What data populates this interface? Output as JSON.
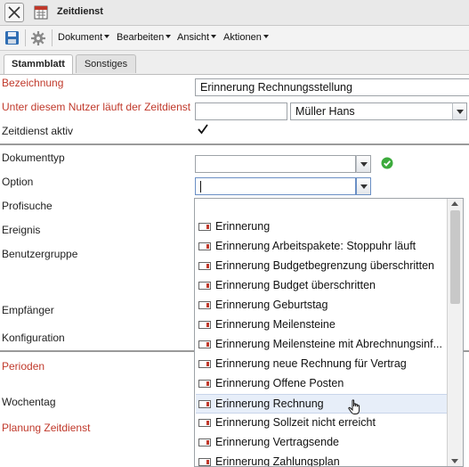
{
  "window": {
    "title": "Zeitdienst"
  },
  "toolbar": {
    "menus": [
      "Dokument",
      "Bearbeiten",
      "Ansicht",
      "Aktionen"
    ]
  },
  "tabs": [
    {
      "label": "Stammblatt",
      "active": true
    },
    {
      "label": "Sonstiges",
      "active": false
    }
  ],
  "form": {
    "bezeichnung": {
      "label": "Bezeichnung",
      "value": "Erinnerung Rechnungsstellung"
    },
    "nutzer": {
      "label": "Unter diesem Nutzer läuft der Zeitdienst",
      "value": "",
      "selected": "Müller Hans"
    },
    "aktiv": {
      "label": "Zeitdienst aktiv",
      "checked": true
    },
    "dokumenttyp": {
      "label": "Dokumenttyp",
      "value": ""
    },
    "option": {
      "label": "Option",
      "value": ""
    },
    "profisuche": {
      "label": "Profisuche"
    },
    "ereignis": {
      "label": "Ereignis"
    },
    "benutzergruppe": {
      "label": "Benutzergruppe"
    },
    "empfaenger": {
      "label": "Empfänger"
    },
    "konfiguration": {
      "label": "Konfiguration"
    },
    "perioden": {
      "label": "Perioden"
    },
    "wochentag": {
      "label": "Wochentag"
    },
    "planung": {
      "label": "Planung Zeitdienst"
    }
  },
  "dropdown": {
    "options": [
      "Erinnerung",
      "Erinnerung Arbeitspakete: Stoppuhr läuft",
      "Erinnerung Budgetbegrenzung überschritten",
      "Erinnerung Budget überschritten",
      "Erinnerung Geburtstag",
      "Erinnerung Meilensteine",
      "Erinnerung Meilensteine mit Abrechnungsinf...",
      "Erinnerung neue Rechnung für Vertrag",
      "Erinnerung Offene Posten",
      "Erinnerung Rechnung",
      "Erinnerung Sollzeit nicht erreicht",
      "Erinnerung Vertragsende",
      "Erinnerung Zahlungsplan"
    ],
    "hovered": "Erinnerung Rechnung",
    "icon": "text-field-icon"
  },
  "colors": {
    "required_label": "#c0392b",
    "hover_row": "#e7eef9",
    "ok_green": "#3cab3c"
  },
  "icons": {
    "close": "close-x-icon",
    "app": "calendar-form-icon",
    "save": "floppy-disk-icon",
    "settings": "gear-icon",
    "ok": "check-circle-icon"
  }
}
